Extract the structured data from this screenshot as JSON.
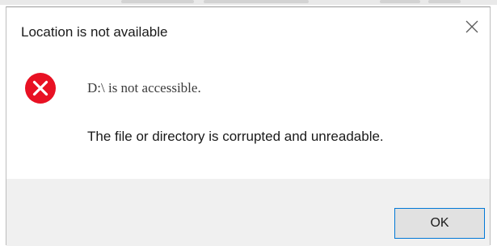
{
  "window": {
    "title": "Location is not available",
    "close_icon": "close-icon"
  },
  "message": {
    "icon": "error-icon",
    "icon_color": "#e81123",
    "primary": "D:\\ is not accessible.",
    "secondary": "The file or directory is corrupted and unreadable."
  },
  "buttons": {
    "ok_label": "OK",
    "accent_color": "#0078d7"
  }
}
